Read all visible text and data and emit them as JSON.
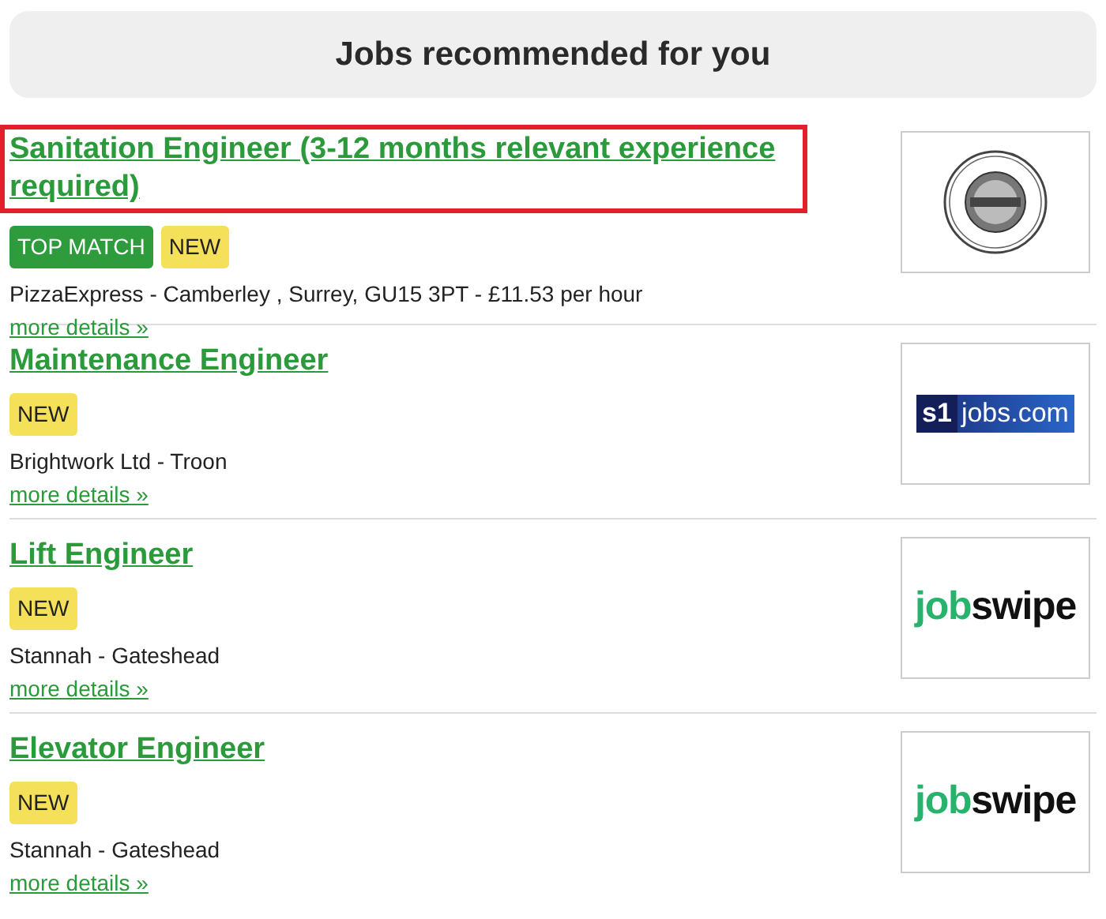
{
  "header": {
    "title": "Jobs recommended for you"
  },
  "jobs": [
    {
      "title": "Sanitation Engineer (3-12 months relevant experience required)",
      "highlighted": true,
      "badges": [
        {
          "kind": "match",
          "label": "TOP MATCH"
        },
        {
          "kind": "new",
          "label": "NEW"
        }
      ],
      "details": "PizzaExpress - Camberley , Surrey, GU15 3PT - £11.53 per hour",
      "link": "more details »",
      "logo": {
        "kind": "seal"
      }
    },
    {
      "title": "Maintenance Engineer",
      "highlighted": false,
      "badges": [
        {
          "kind": "new",
          "label": "NEW"
        }
      ],
      "details": "Brightwork Ltd - Troon",
      "link": "more details »",
      "logo": {
        "kind": "s1jobs",
        "mark": "s1",
        "text": "jobs.com"
      }
    },
    {
      "title": "Lift Engineer",
      "highlighted": false,
      "badges": [
        {
          "kind": "new",
          "label": "NEW"
        }
      ],
      "details": "Stannah - Gateshead",
      "link": "more details »",
      "logo": {
        "kind": "jobswipe",
        "first": "job",
        "second": "swipe"
      }
    },
    {
      "title": "Elevator Engineer",
      "highlighted": false,
      "badges": [
        {
          "kind": "new",
          "label": "NEW"
        }
      ],
      "details": "Stannah - Gateshead",
      "link": "more details »",
      "logo": {
        "kind": "jobswipe",
        "first": "job",
        "second": "swipe"
      }
    }
  ]
}
